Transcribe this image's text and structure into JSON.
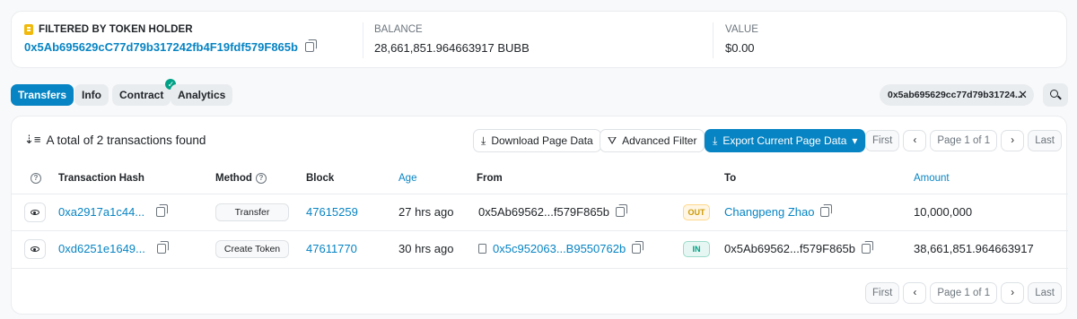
{
  "holder": {
    "title": "FILTERED BY TOKEN HOLDER",
    "address": "0x5Ab695629cC77d79b317242fb4F19fdf579F865b"
  },
  "balance": {
    "label": "BALANCE",
    "value": "28,661,851.964663917 BUBB"
  },
  "value": {
    "label": "VALUE",
    "value": "$0.00"
  },
  "tabs": [
    {
      "label": "Transfers",
      "active": true
    },
    {
      "label": "Info"
    },
    {
      "label": "Contract",
      "verified": true
    },
    {
      "label": "Analytics"
    }
  ],
  "filter_chip": {
    "text": "0x5ab695629cc77d79b31724...",
    "close_icon": "close-icon"
  },
  "summary": "A total of 2 transactions found",
  "toolbar": {
    "download_label": "Download Page Data",
    "advanced_filter_label": "Advanced Filter",
    "export_label": "Export Current Page Data"
  },
  "pagination": {
    "first": "First",
    "page": "Page 1 of 1",
    "last": "Last",
    "prev": "‹",
    "next": "›"
  },
  "columns": {
    "hash": "Transaction Hash",
    "method": "Method",
    "block": "Block",
    "age": "Age",
    "from": "From",
    "to": "To",
    "amount": "Amount"
  },
  "rows": [
    {
      "hash": "0xa2917a1c44...",
      "method": "Transfer",
      "block": "47615259",
      "age": "27 hrs ago",
      "from": "0x5Ab69562...f579F865b",
      "direction": "OUT",
      "to": "Changpeng Zhao",
      "amount": "10,000,000"
    },
    {
      "hash": "0xd6251e1649...",
      "method": "Create Token",
      "block": "47611770",
      "age": "30 hrs ago",
      "from": "0x5c952063...B9550762b",
      "direction": "IN",
      "to": "0x5Ab69562...f579F865b",
      "amount": "38,661,851.964663917"
    }
  ],
  "colors": {
    "accent": "#0784c3",
    "out": "#cc9a06",
    "in": "#00a186",
    "verified": "#00a186"
  }
}
